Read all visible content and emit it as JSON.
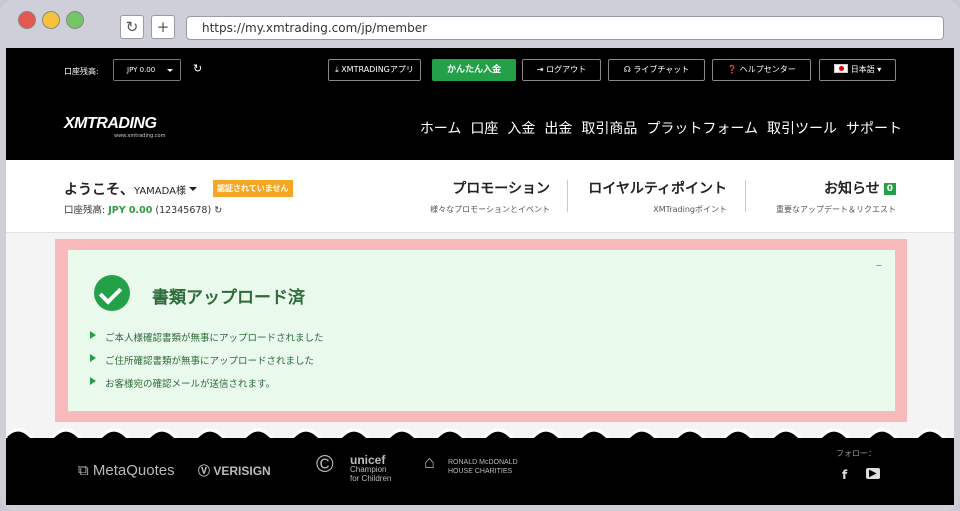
{
  "browser": {
    "url": "https://my.xmtrading.com/jp/member",
    "reload_icon": "reload-icon",
    "newtab_label": "+"
  },
  "topbar": {
    "balance_label": "口座残高:",
    "currency_select": "JPY 0.00",
    "app_button": "XMTRADINGアプリ",
    "deposit_button": "かんたん入金",
    "logout_button": "ログアウト",
    "chat_button": "ライブチャット",
    "help_button": "ヘルプセンター",
    "language": "日本語"
  },
  "navbar": {
    "logo": "XMTRADING",
    "logo_sub": "www.xmtrading.com",
    "items": [
      "ホーム",
      "口座",
      "入金",
      "出金",
      "取引商品",
      "プラットフォーム",
      "取引ツール",
      "サポート"
    ]
  },
  "welcome": {
    "greeting": "ようこそ、",
    "name": "YAMADA様",
    "verify_badge": "認証されていません",
    "balance_label": "口座残高: ",
    "balance_value": "JPY 0.00",
    "account_id": "(12345678)",
    "promo_title": "プロモーション",
    "promo_sub": "様々なプロモーションとイベント",
    "loyalty_title": "ロイヤルティポイント",
    "loyalty_sub": "XMTradingポイント",
    "news_title": "お知らせ",
    "news_count": "0",
    "news_sub": "重要なアップデート＆リクエスト"
  },
  "notice": {
    "title": "書類アップロード済",
    "items": [
      "ご本人様確認書類が無事にアップロードされました",
      "ご住所確認書類が無事にアップロードされました",
      "お客様宛の確認メールが送信されます。"
    ],
    "minimize": "–"
  },
  "footer": {
    "partners": [
      "MetaQuotes",
      "VERISIGN",
      "unicef",
      "Champion",
      "for Children",
      "RONALD McDONALD",
      "HOUSE CHARITIES"
    ],
    "follow_label": "フォロー：",
    "social": [
      "f",
      "▶"
    ]
  },
  "colors": {
    "accent_green": "#24a148",
    "warn_orange": "#f5a623",
    "highlight_pink": "#f8b9bb"
  }
}
